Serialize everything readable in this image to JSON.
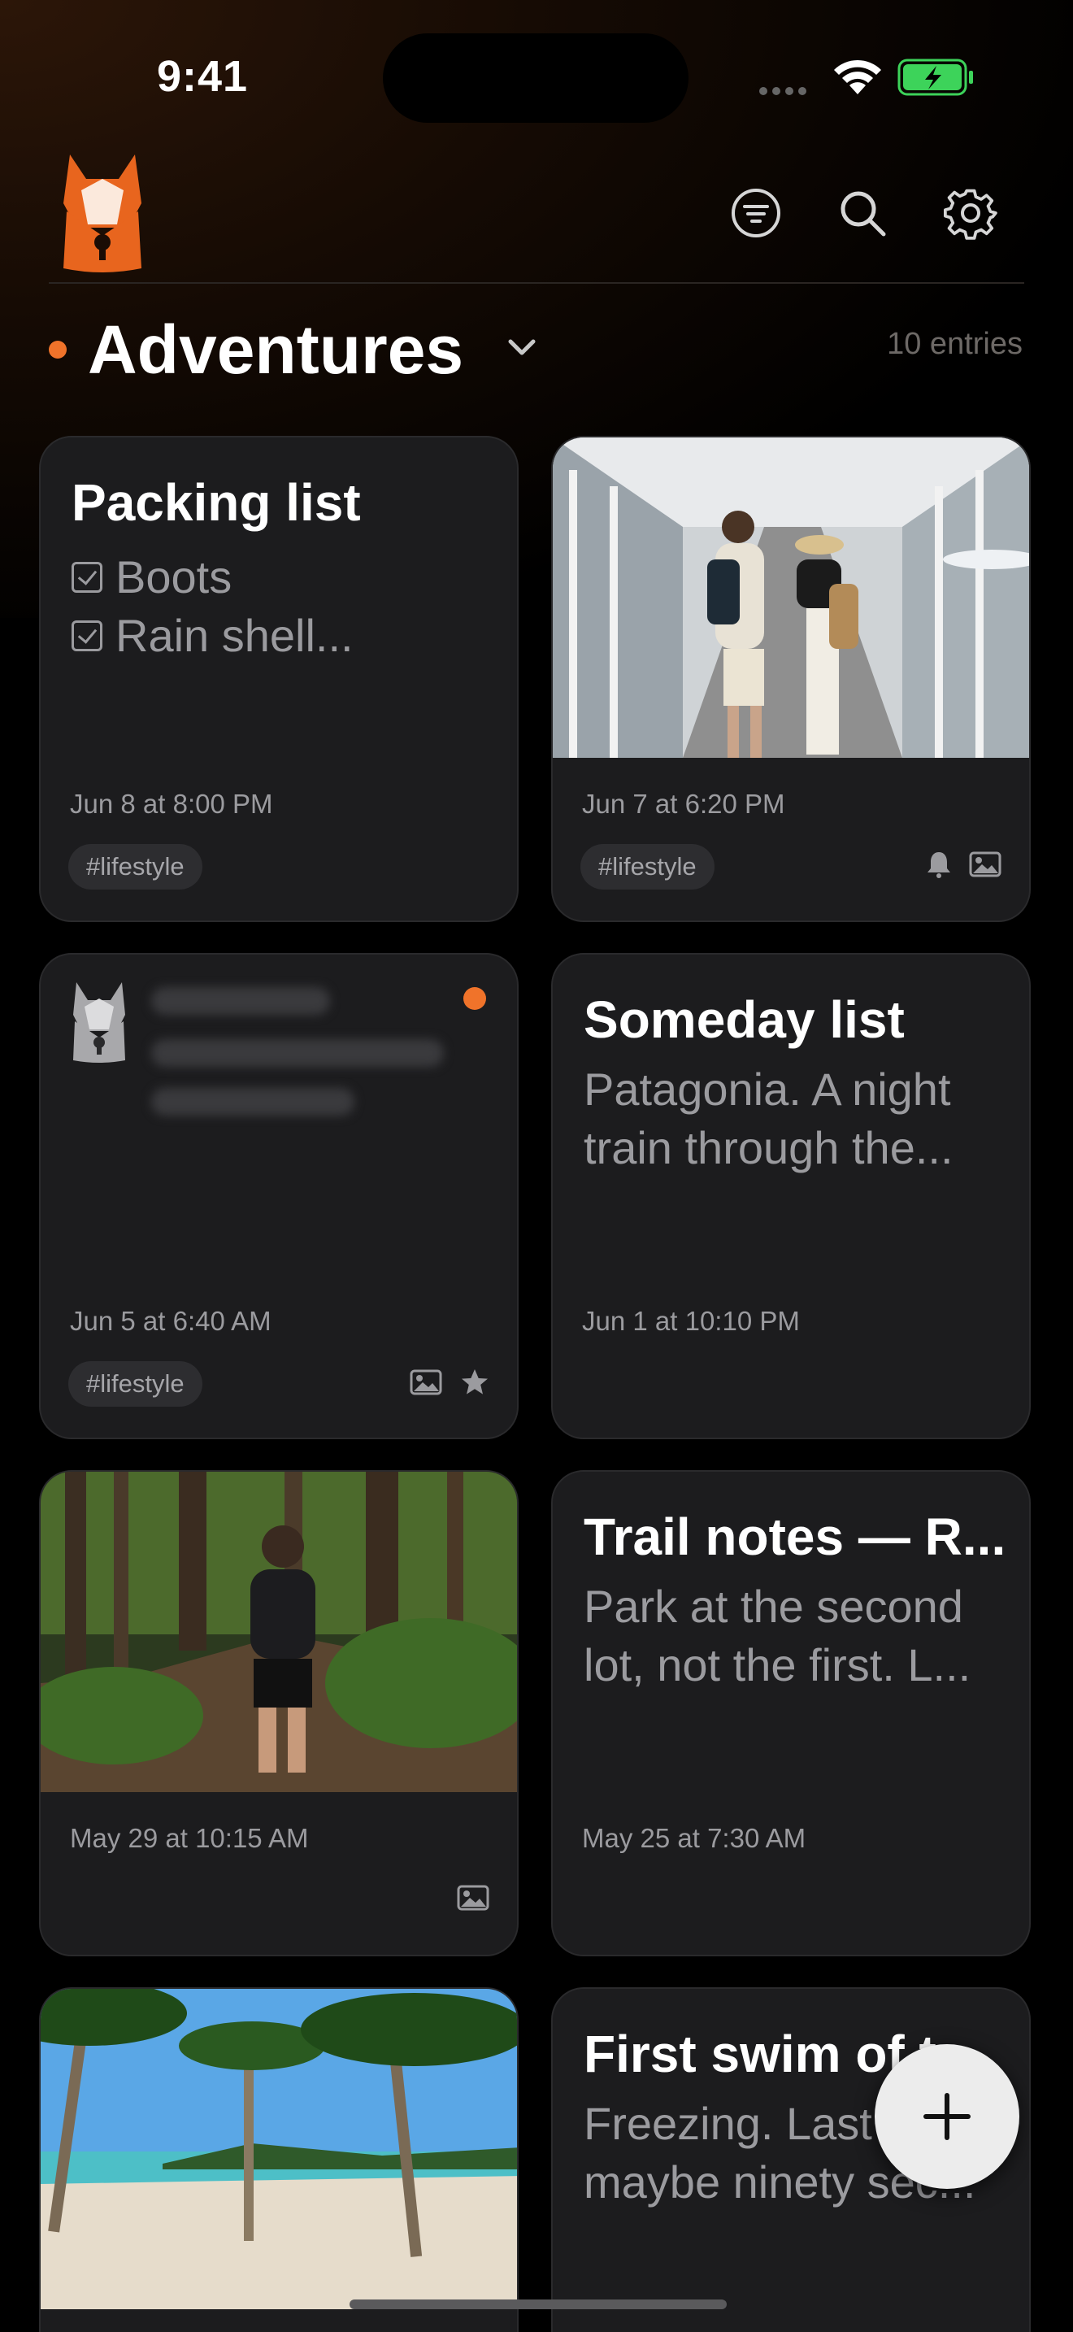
{
  "status_bar": {
    "time": "9:41"
  },
  "header": {
    "title": "Adventures",
    "entry_count": "10 entries"
  },
  "cards": [
    {
      "title": "Packing list",
      "checklist": [
        "Boots",
        "Rain shell..."
      ],
      "date": "Jun 8 at 8:00 PM",
      "tag": "#lifestyle"
    },
    {
      "date": "Jun 7 at 6:20 PM",
      "tag": "#lifestyle",
      "photo": "couple-airport-jetbridge",
      "icons": [
        "bell-icon",
        "image-icon"
      ]
    },
    {
      "date": "Jun 5 at 6:40 AM",
      "tag": "#lifestyle",
      "locked": true,
      "unread": true,
      "icons": [
        "image-icon",
        "star-icon"
      ]
    },
    {
      "title": "Someday list",
      "body": "Patagonia. A night train through the...",
      "date": "Jun 1 at 10:10 PM"
    },
    {
      "date": "May 29 at 10:15 AM",
      "photo": "hiker-forest-trail",
      "icons": [
        "image-icon"
      ]
    },
    {
      "title": "Trail notes — R...",
      "body": "Park at the second lot, not the first. L...",
      "date": "May 25 at 7:30 AM"
    },
    {
      "photo": "tropical-beach-palms"
    },
    {
      "title": "First swim of t",
      "body": "Freezing. Last maybe ninety sec..."
    }
  ],
  "colors": {
    "accent": "#f0732a",
    "card": "#1c1c1e",
    "muted": "#9b9b9f"
  }
}
